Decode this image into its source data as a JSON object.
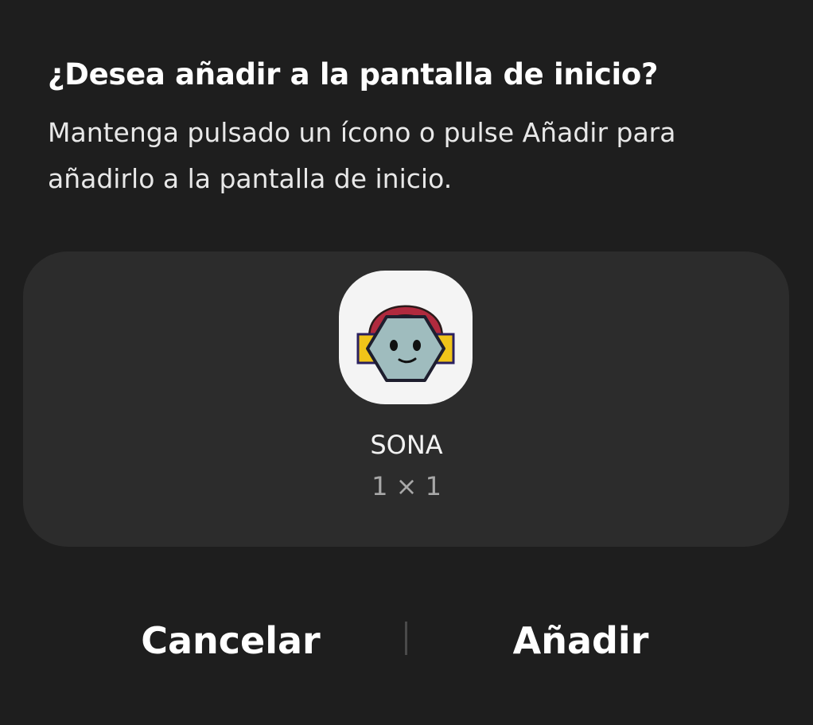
{
  "dialog": {
    "title": "¿Desea añadir a la pantalla de inicio?",
    "message": "Mantenga pulsado un ícono o pulse Añadir para añadirlo a la pantalla de inicio."
  },
  "preview": {
    "app_icon": "sona-app-icon",
    "app_name": "SONA",
    "size_label": "1 × 1"
  },
  "buttons": {
    "cancel_label": "Cancelar",
    "add_label": "Añadir"
  },
  "colors": {
    "background": "#1e1e1e",
    "card": "#2c2c2c",
    "icon_background": "#f4f4f4",
    "headphone_band": "#b02a3e",
    "headphone_cup": "#f0c419",
    "face": "#9fbcbe"
  }
}
